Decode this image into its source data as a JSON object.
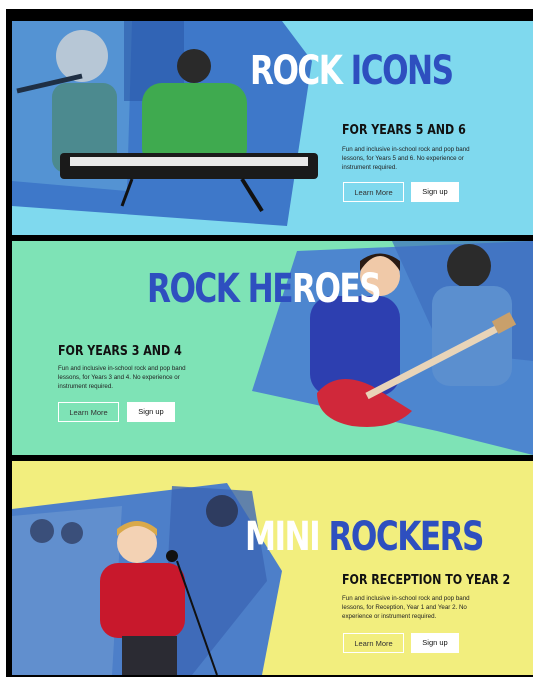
{
  "panels": [
    {
      "title_part1": "ROCK",
      "title_part2": " ICONS",
      "subtitle": "FOR YEARS 5 AND 6",
      "description": "Fun and inclusive in-school rock and pop band lessons, for Years 5 and 6. No experience or instrument required.",
      "learn_more": "Learn More",
      "sign_up": "Sign up",
      "bg_color": "#7fd9ee"
    },
    {
      "title_part1": "ROCK HE",
      "title_part2": "ROES",
      "subtitle": "FOR YEARS 3 AND 4",
      "description": "Fun and inclusive in-school rock and pop band lessons, for Years 3 and 4. No experience or instrument required.",
      "learn_more": "Learn More",
      "sign_up": "Sign up",
      "bg_color": "#7ee3b6"
    },
    {
      "title_part1": "MINI",
      "title_part2": " ROCKERS",
      "subtitle": "FOR RECEPTION TO YEAR 2",
      "description": "Fun and inclusive in-school rock and pop band lessons, for Reception, Year 1 and Year 2. No experience or instrument required.",
      "learn_more": "Learn More",
      "sign_up": "Sign up",
      "bg_color": "#f2ee7e"
    }
  ]
}
